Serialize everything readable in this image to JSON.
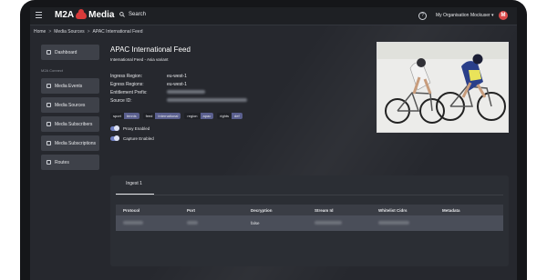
{
  "header": {
    "brand_left": "M2A",
    "brand_right": "Media",
    "search_label": "Search",
    "org_label": "My Organisation",
    "user_label": "Mockuser ▾",
    "avatar_initial": "M"
  },
  "breadcrumb": {
    "items": [
      "Home",
      "Media Sources",
      "APAC International Feed"
    ]
  },
  "sidebar": {
    "items": [
      {
        "label": "Dashboard",
        "icon": "grid-icon"
      },
      {
        "label": "Media Events",
        "icon": "calendar-icon"
      },
      {
        "label": "Media Sources",
        "icon": "sources-icon"
      },
      {
        "label": "Media Subscribers",
        "icon": "link-icon"
      },
      {
        "label": "Media Subscriptions",
        "icon": "list-icon"
      },
      {
        "label": "Routes",
        "icon": "share-icon"
      }
    ],
    "section_label": "M2A Connect"
  },
  "main": {
    "title": "APAC International Feed",
    "subtitle": "International Feed - Asia variant",
    "fields": [
      {
        "label": "Ingress Region:",
        "value": "eu-west-1"
      },
      {
        "label": "Egress Regions:",
        "value": "eu-west-1"
      },
      {
        "label": "Entitlement Prefix:",
        "value": ""
      },
      {
        "label": "Source ID:",
        "value": ""
      }
    ],
    "tags": [
      {
        "key": "sport",
        "value": "tennis"
      },
      {
        "key": "feed",
        "value": "International"
      },
      {
        "key": "region",
        "value": "apac"
      },
      {
        "key": "rights",
        "value": "def"
      }
    ],
    "toggles": [
      {
        "label": "Proxy Enabled",
        "on": true
      },
      {
        "label": "Capture Enabled",
        "on": true
      }
    ]
  },
  "ingest": {
    "tab_label": "Ingest 1",
    "columns": [
      "Protocol",
      "Port",
      "Decryption",
      "Stream Id",
      "Whitelist Cidrs",
      "Metadata"
    ],
    "rows": [
      {
        "protocol": "",
        "port": "",
        "decryption": "false",
        "stream_id": "",
        "whitelist": "",
        "metadata": ""
      }
    ]
  },
  "colors": {
    "accent": "#d83a3a",
    "toggle": "#6f7fc2",
    "tag_value": "#5a5f8e",
    "panel": "#2b2e34"
  }
}
